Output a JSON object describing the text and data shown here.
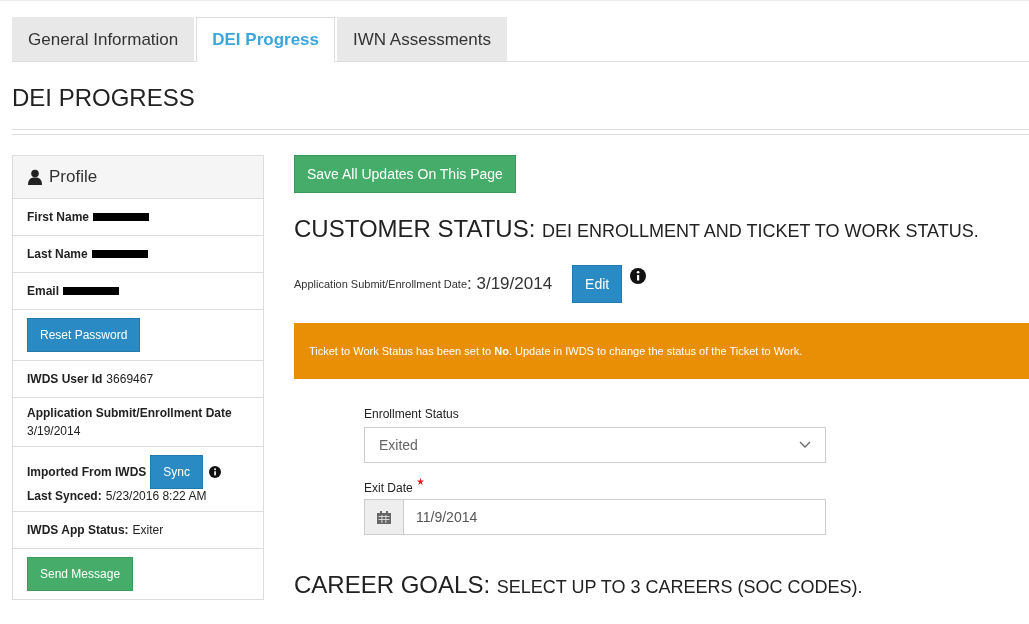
{
  "tabs": [
    {
      "label": "General Information",
      "selected": false
    },
    {
      "label": "DEI Progress",
      "selected": true
    },
    {
      "label": "IWN Assessments",
      "selected": false
    }
  ],
  "page_title": "DEI PROGRESS",
  "profile": {
    "title": "Profile",
    "rows": [
      {
        "kind": "field",
        "label": "First Name",
        "redacted": true
      },
      {
        "kind": "field",
        "label": "Last Name",
        "redacted": true
      },
      {
        "kind": "field",
        "label": "Email",
        "redacted": true
      },
      {
        "kind": "button",
        "label": "Reset Password",
        "color": "#2a8bc4"
      },
      {
        "kind": "field",
        "label": "IWDS User Id",
        "value": "3669467"
      },
      {
        "kind": "stacked",
        "label": "Application Submit/Enrollment Date",
        "value": "3/19/2014"
      },
      {
        "kind": "sync",
        "label": "Imported From IWDS",
        "button": "Sync",
        "sub_label": "Last Synced:",
        "sub_value": "5/23/2016 8:22 AM"
      },
      {
        "kind": "field",
        "label": "IWDS App Status:",
        "value": "Exiter"
      },
      {
        "kind": "button",
        "label": "Send Message",
        "color": "#45ad69"
      }
    ]
  },
  "save_button": "Save All Updates On This Page",
  "customer_status": {
    "title": "CUSTOMER STATUS:",
    "subtitle": "DEI ENROLLMENT AND TICKET TO WORK STATUS.",
    "date_label": "Application Submit/Enrollment Date",
    "date_value": ": 3/19/2014",
    "edit_button": "Edit"
  },
  "alert": "Ticket to Work Status has been set to **No**. Update in IWDS to change the status of the Ticket to Work.",
  "enrollment_status": {
    "label": "Enrollment Status",
    "value": "Exited"
  },
  "exit_date": {
    "label": "Exit Date",
    "required": true,
    "value": "11/9/2014"
  },
  "career_goals": {
    "title": "CAREER GOALS:",
    "subtitle": "SELECT UP TO 3 CAREERS (SOC CODES)."
  }
}
